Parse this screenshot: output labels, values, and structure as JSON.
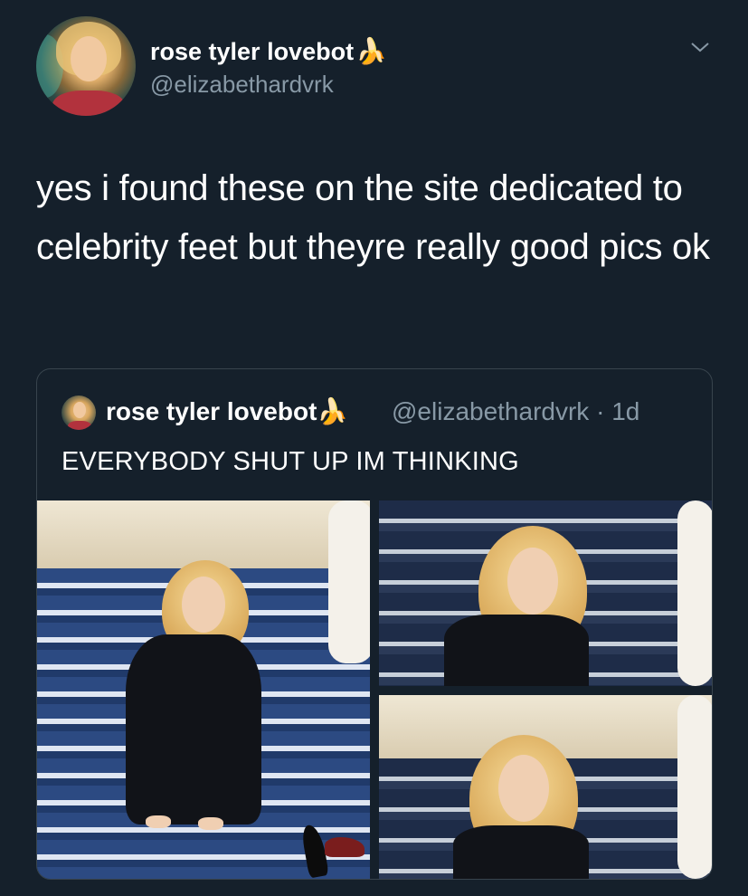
{
  "tweet": {
    "author": {
      "display_name": "rose tyler lovebot",
      "emoji": "🍌",
      "handle": "@elizabethardvrk"
    },
    "text": "yes i found these on the site dedicated to celebrity feet but theyre really good pics ok",
    "menu_icon": "chevron-down-icon"
  },
  "quoted_tweet": {
    "author": {
      "display_name": "rose tyler lovebot",
      "emoji": "🍌",
      "handle": "@elizabethardvrk",
      "separator": "·",
      "time": "1d"
    },
    "text": "EVERYBODY SHUT UP IM THINKING"
  },
  "colors": {
    "background": "#15202b",
    "text_primary": "#ffffff",
    "text_secondary": "#8899a6",
    "border": "#38444d"
  }
}
